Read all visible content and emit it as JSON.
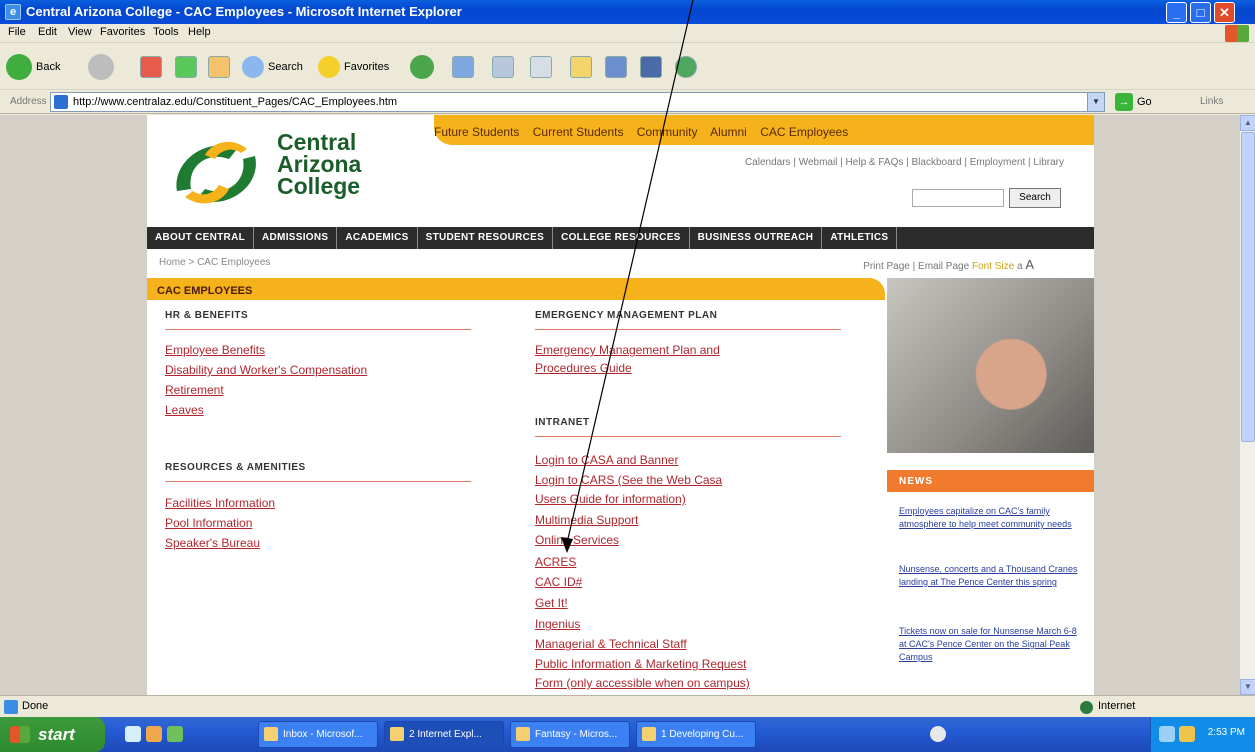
{
  "window": {
    "title": "Central Arizona College - CAC Employees - Microsoft Internet Explorer",
    "min": "_",
    "max": "□",
    "close": "✕"
  },
  "menu": [
    "File",
    "Edit",
    "View",
    "Favorites",
    "Tools",
    "Help"
  ],
  "toolbar": {
    "back": "Back",
    "search": "Search",
    "favorites": "Favorites"
  },
  "address": {
    "label": "Address",
    "url": "http://www.centralaz.edu/Constituent_Pages/CAC_Employees.htm",
    "go": "Go",
    "links": "Links"
  },
  "site": {
    "logo_text": [
      "Central",
      "Arizona",
      "College"
    ],
    "topnav": [
      "Future Students",
      "Current Students",
      "Community",
      "Alumni",
      "CAC Employees"
    ],
    "utilnav": "Calendars | Webmail | Help & FAQs | Blackboard | Employment | Library",
    "search_button": "Search",
    "mainnav": [
      "ABOUT CENTRAL",
      "ADMISSIONS",
      "ACADEMICS",
      "STUDENT RESOURCES",
      "COLLEGE RESOURCES",
      "BUSINESS OUTREACH",
      "ATHLETICS"
    ],
    "breadcrumb": "Home > CAC Employees",
    "print": "Print Page | Email Page",
    "font_size_label": "Font Size",
    "font_small": "a",
    "font_large": "A",
    "section_title": "CAC EMPLOYEES",
    "hr_heading": "HR & BENEFITS",
    "hr_links": [
      "Employee Benefits",
      "Disability and Worker's Compensation",
      "Retirement",
      "Leaves"
    ],
    "res_heading": "RESOURCES & AMENITIES",
    "res_links": [
      "Facilities Information",
      "Pool Information",
      "Speaker's Bureau"
    ],
    "emp_heading": "EMERGENCY MANAGEMENT PLAN",
    "emp_links": [
      "Emergency Management Plan and",
      "Procedures Guide"
    ],
    "intranet_heading": "INTRANET",
    "intranet_links": [
      "Login to CASA and Banner",
      "Login to CARS (See the Web Casa",
      "Users Guide for information)",
      "Multimedia Support",
      "Online Services",
      "ACRES",
      "CAC ID#",
      "Get It!",
      "Ingenius",
      "Managerial & Technical Staff",
      "Public Information & Marketing Request",
      "Form (only accessible when on campus)"
    ],
    "news_title": "NEWS",
    "news_items": [
      "Employees capitalize on CAC's family atmosphere to help meet community needs",
      "Nunsense, concerts and a Thousand Cranes landing at The Pence Center this spring",
      "Tickets now on sale for Nunsense March 6-8 at CAC's Pence Center on the Signal Peak Campus"
    ]
  },
  "status": {
    "left": "Done",
    "zone": "Internet"
  },
  "taskbar": {
    "start": "start",
    "tasks": [
      "Inbox - Microsof...",
      "2 Internet Expl...",
      "Fantasy - Micros...",
      "1 Developing Cu..."
    ],
    "clock": "2:53 PM"
  }
}
